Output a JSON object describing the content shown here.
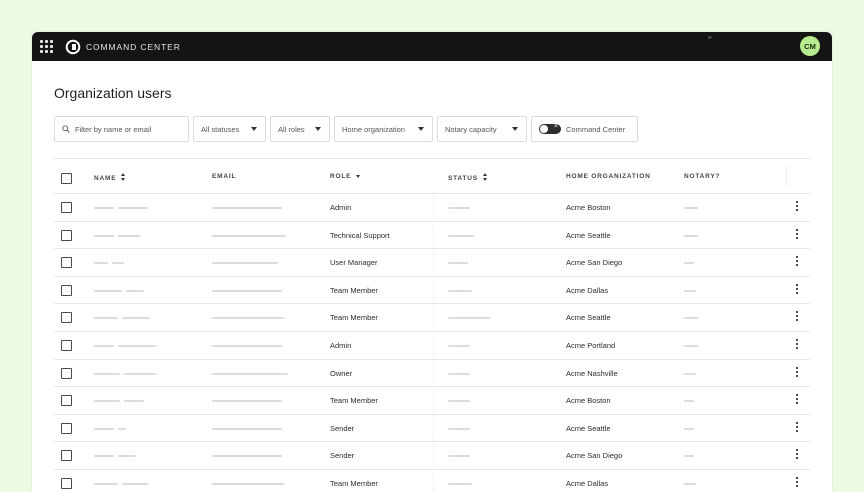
{
  "app": {
    "title": "COMMAND CENTER",
    "user_initials": "CM",
    "tiny_mark": "⊳"
  },
  "page": {
    "title": "Organization users"
  },
  "filters": {
    "search_placeholder": "Filter by name or email",
    "status": "All statuses",
    "role": "All roles",
    "home_org": "Home organization",
    "notary": "Notary capacity",
    "toggle_label": "Command Center"
  },
  "table": {
    "columns": {
      "name": "NAME",
      "email": "EMAIL",
      "role": "ROLE",
      "status": "STATUS",
      "home_org": "HOME ORGANIZATION",
      "notary": "NOTARY?"
    },
    "rows": [
      {
        "role": "Admin",
        "home_org": "Acme Boston"
      },
      {
        "role": "Technical Support",
        "home_org": "Acme Seattle"
      },
      {
        "role": "User Manager",
        "home_org": "Acme San Diego"
      },
      {
        "role": "Team Member",
        "home_org": "Acme Dallas"
      },
      {
        "role": "Team Member",
        "home_org": "Acme Seattle"
      },
      {
        "role": "Admin",
        "home_org": "Acme Portland"
      },
      {
        "role": "Owner",
        "home_org": "Acme Nashville"
      },
      {
        "role": "Team Member",
        "home_org": "Acme Boston"
      },
      {
        "role": "Sender",
        "home_org": "Acme Seattle"
      },
      {
        "role": "Sender",
        "home_org": "Acme San Diego"
      },
      {
        "role": "Team Member",
        "home_org": "Acme Dallas"
      }
    ]
  },
  "colors": {
    "topbar": "#141414",
    "avatar": "#b6ec8f",
    "background": "#eef9e4"
  }
}
